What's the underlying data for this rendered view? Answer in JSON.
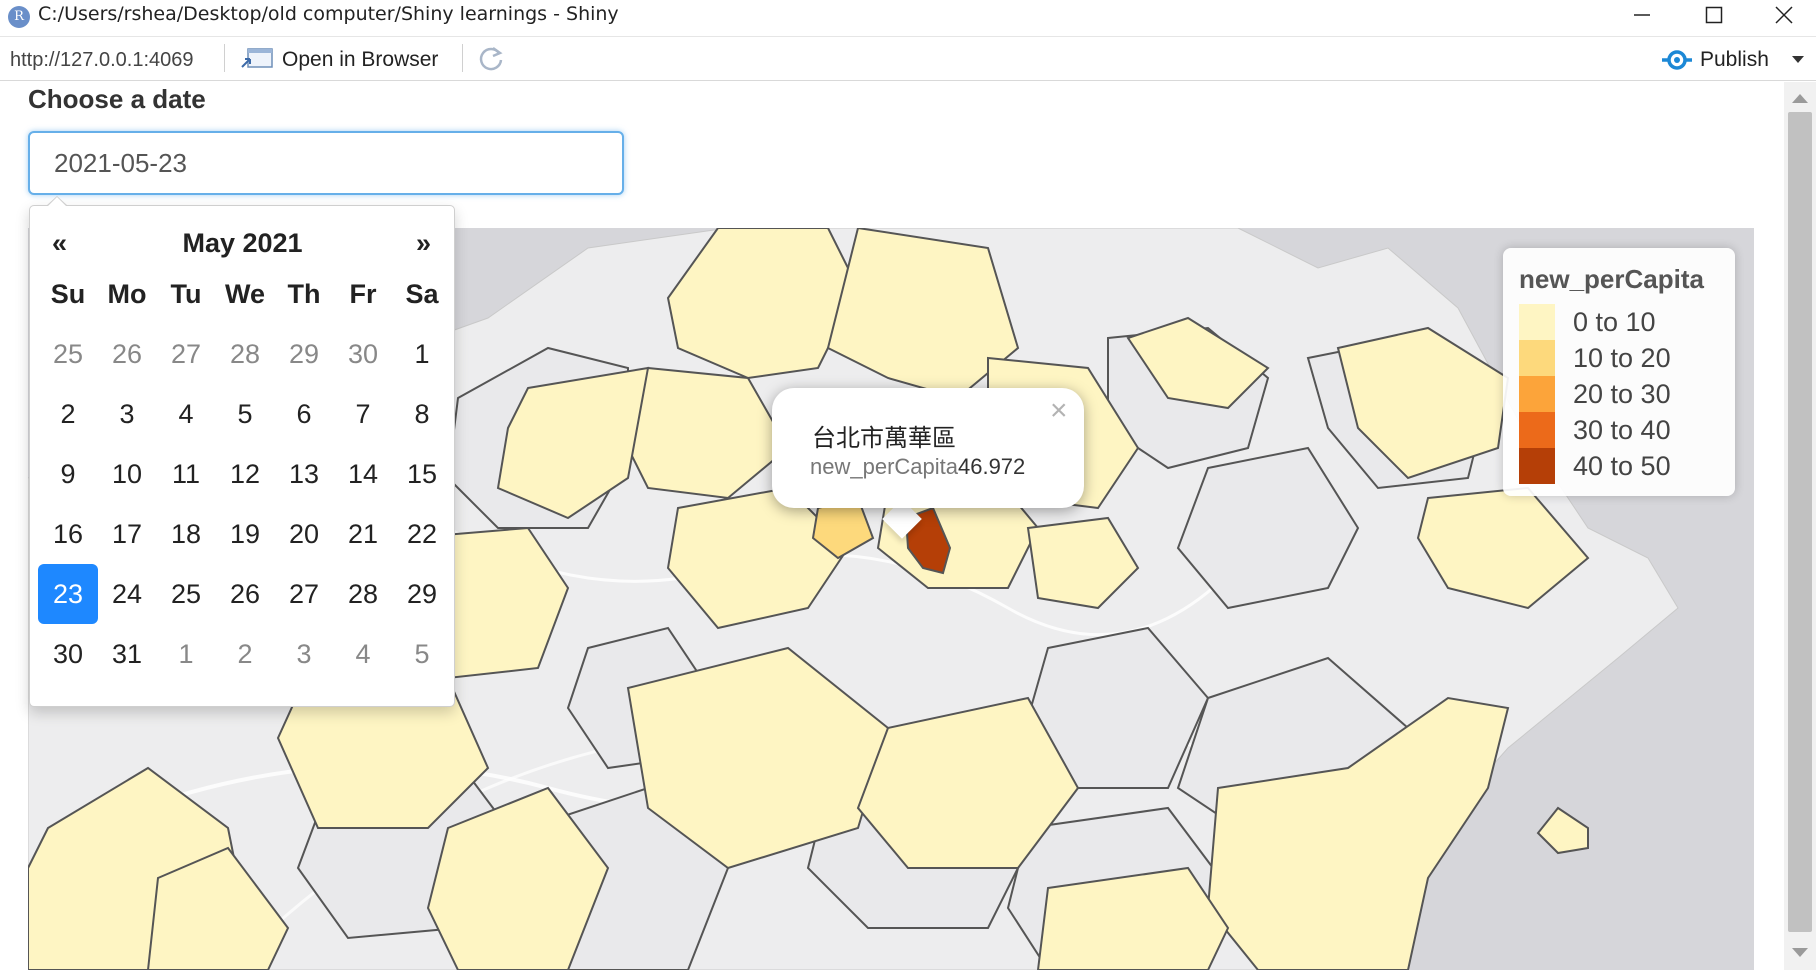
{
  "window": {
    "icon_letter": "R",
    "title": "C:/Users/rshea/Desktop/old computer/Shiny learnings - Shiny"
  },
  "toolbar": {
    "url": "http://127.0.0.1:4069",
    "open_in_browser_label": "Open in Browser",
    "publish_label": "Publish"
  },
  "date_input": {
    "label": "Choose a date",
    "value": "2021-05-23"
  },
  "datepicker": {
    "prev": "«",
    "next": "»",
    "month_title": "May 2021",
    "weekdays": [
      "Su",
      "Mo",
      "Tu",
      "We",
      "Th",
      "Fr",
      "Sa"
    ],
    "weeks": [
      [
        "25",
        "26",
        "27",
        "28",
        "29",
        "30",
        "1"
      ],
      [
        "2",
        "3",
        "4",
        "5",
        "6",
        "7",
        "8"
      ],
      [
        "9",
        "10",
        "11",
        "12",
        "13",
        "14",
        "15"
      ],
      [
        "16",
        "17",
        "18",
        "19",
        "20",
        "21",
        "22"
      ],
      [
        "23",
        "24",
        "25",
        "26",
        "27",
        "28",
        "29"
      ],
      [
        "30",
        "31",
        "1",
        "2",
        "3",
        "4",
        "5"
      ]
    ],
    "selected": "23"
  },
  "map": {
    "zoom_in": "+",
    "zoom_out": "−",
    "layers_icon": "layers-icon",
    "popup": {
      "close": "×",
      "district": "台北市萬華區",
      "key": "new_perCapita",
      "value": "46.972"
    },
    "legend": {
      "title": "new_perCapita",
      "items": [
        {
          "label": "0 to 10",
          "color": "#fef5c3"
        },
        {
          "label": "10 to 20",
          "color": "#fdd97c"
        },
        {
          "label": "20 to 30",
          "color": "#fca43a"
        },
        {
          "label": "30 to 40",
          "color": "#ec6a1a"
        },
        {
          "label": "40 to 50",
          "color": "#b53f07"
        }
      ]
    }
  }
}
